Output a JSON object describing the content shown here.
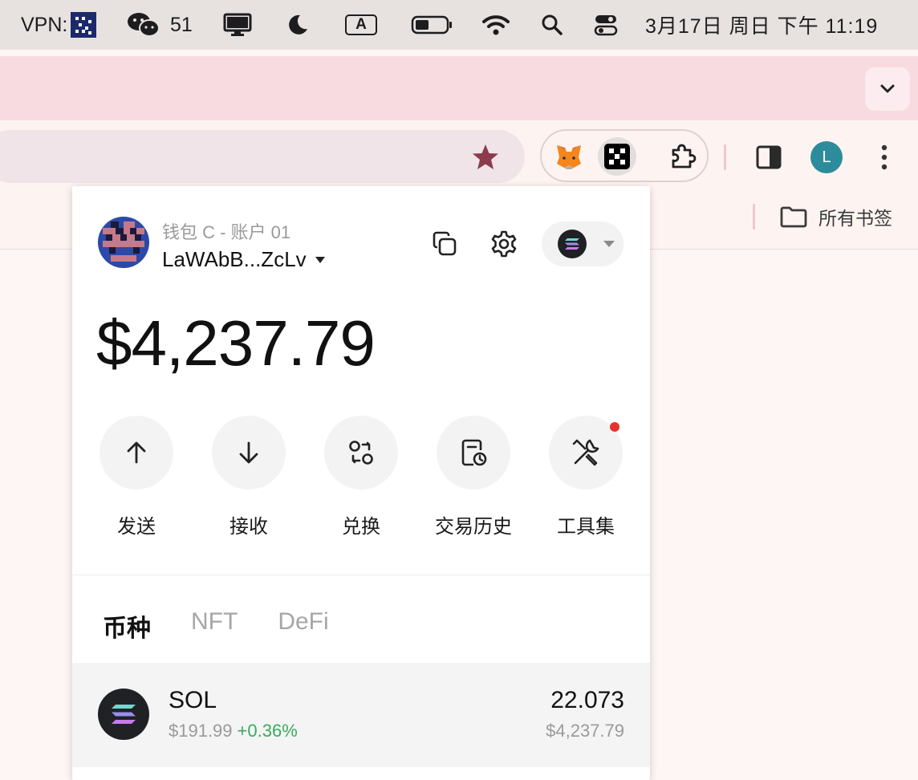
{
  "menubar": {
    "vpn_label": "VPN:",
    "wechat_count": "51",
    "input_method": "A",
    "datetime": "3月17日 周日  下午 11:19"
  },
  "bookmarks": {
    "all_label": "所有书签"
  },
  "account": {
    "avatar_initial": "L",
    "wallet_label": "钱包 C - 账户 01",
    "address": "LaWAbB...ZcLv"
  },
  "wallet": {
    "balance": "$4,237.79",
    "actions": [
      {
        "label": "发送",
        "icon": "send-arrow-up-icon"
      },
      {
        "label": "接收",
        "icon": "receive-arrow-down-icon"
      },
      {
        "label": "兑换",
        "icon": "swap-icon"
      },
      {
        "label": "交易历史",
        "icon": "history-icon"
      },
      {
        "label": "工具集",
        "icon": "tools-icon"
      }
    ],
    "tabs": [
      "币种",
      "NFT",
      "DeFi"
    ],
    "tokens": [
      {
        "name": "SOL",
        "price": "$191.99",
        "change": "+0.36%",
        "amount": "22.073",
        "value": "$4,237.79"
      }
    ]
  },
  "colors": {
    "brand_pink": "#f8dbe0",
    "positive": "#3aaa5c",
    "notify": "#e5322d"
  }
}
